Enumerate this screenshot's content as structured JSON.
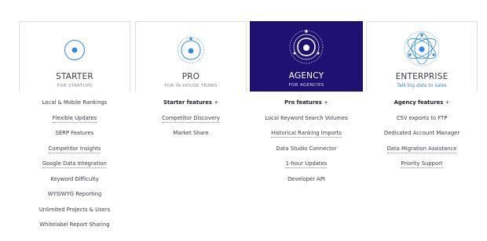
{
  "plans": [
    {
      "name": "STARTER",
      "subtitle": "FOR STARTUPS",
      "icon": "starter-orbit-icon",
      "features": [
        {
          "label": "Local & Mobile Rankings",
          "dotted": false
        },
        {
          "label": "Flexible Updates",
          "dotted": true
        },
        {
          "label": "SERP Features",
          "dotted": false
        },
        {
          "label": "Competitor Insights",
          "dotted": true
        },
        {
          "label": "Google Data Integration",
          "dotted": true
        },
        {
          "label": "Keyword Difficulty",
          "dotted": false
        },
        {
          "label": "WYSIWYG Reporting",
          "dotted": false
        },
        {
          "label": "Unlimited Projects & Users",
          "dotted": false
        },
        {
          "label": "Whitelabel Report Sharing",
          "dotted": false
        }
      ]
    },
    {
      "name": "PRO",
      "subtitle": "FOR IN-HOUSE TEAMS",
      "icon": "pro-orbit-icon",
      "includes": "Starter features",
      "features": [
        {
          "label": "Competitor Discovery",
          "dotted": true
        },
        {
          "label": "Market Share",
          "dotted": false
        }
      ]
    },
    {
      "name": "AGENCY",
      "subtitle": "FOR AGENCIES",
      "icon": "agency-orbit-icon",
      "includes": "Pro features",
      "features": [
        {
          "label": "Local Keyword Search Volumes",
          "dotted": false
        },
        {
          "label": "Historical Ranking Imports",
          "dotted": true
        },
        {
          "label": "Data Studio Connector",
          "dotted": false
        },
        {
          "label": "1-hour Updates",
          "dotted": true
        },
        {
          "label": "Developer API",
          "dotted": false
        }
      ]
    },
    {
      "name": "ENTERPRISE",
      "subtitle": "Talk big data to sales",
      "icon": "enterprise-orbit-icon",
      "includes": "Agency features",
      "features": [
        {
          "label": "CSV exports to FTP",
          "dotted": false
        },
        {
          "label": "Dedicated Account Manager",
          "dotted": false
        },
        {
          "label": "Data Migration Assistance",
          "dotted": true
        },
        {
          "label": "Priority Support",
          "dotted": true
        }
      ]
    }
  ],
  "plus_symbol": "+",
  "colors": {
    "accent_blue": "#2f8ae5",
    "active_card_bg": "#1f1172",
    "text": "#3a3a46",
    "muted": "#8a8a95"
  }
}
